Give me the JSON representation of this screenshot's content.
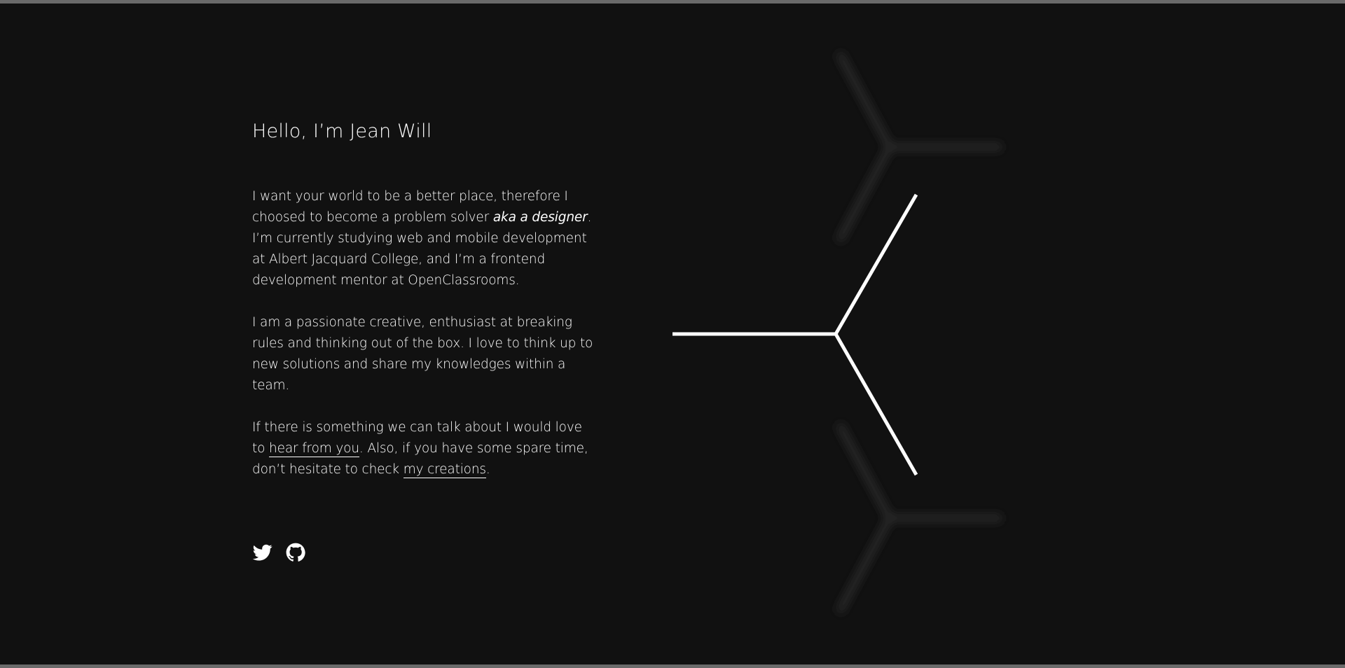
{
  "header": {
    "greeting": "Hello, I’m Jean Will"
  },
  "intro": {
    "p1_a": "I want your world to be a better place, therefore I choosed to become a problem solver ",
    "p1_emph": "aka a designer",
    "p1_b": ". I’m currently studying web and mobile development at Albert Jacquard College, and I’m a frontend development mentor at OpenClassrooms.",
    "p2": "I am a passionate creative, enthusiast at breaking rules and thinking out of the box. I love to think up to new solutions and share my knowledges within a team.",
    "p3_a": "If there is something we can talk about I would love to ",
    "p3_link1": "hear from you",
    "p3_b": ". Also, if you have some spare time, don’t hesitate to check ",
    "p3_link2": "my creations",
    "p3_c": "."
  },
  "social": {
    "icons": [
      "twitter-icon",
      "github-icon"
    ]
  },
  "colors": {
    "background": "#111111",
    "text": "#ffffff",
    "frame": "#6a6a6a",
    "ghost": "#2a2a2a"
  }
}
